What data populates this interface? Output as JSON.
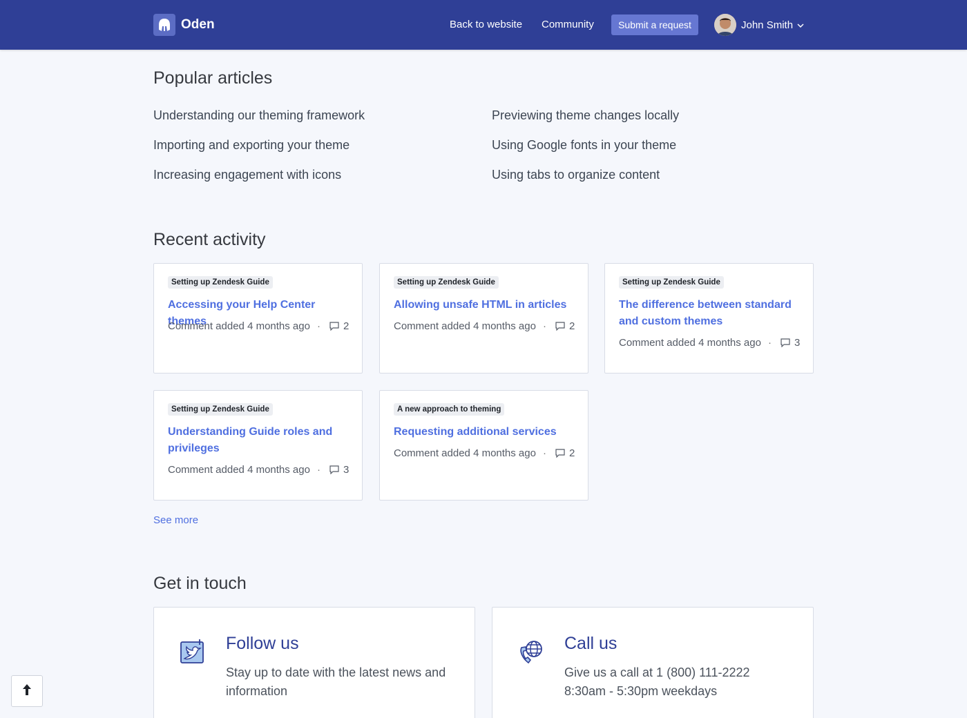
{
  "header": {
    "brand": "Oden",
    "nav": {
      "back_to_website": "Back to website",
      "community": "Community",
      "submit_request": "Submit a request"
    },
    "user_name": "John Smith"
  },
  "popular": {
    "heading": "Popular articles",
    "articles": [
      "Understanding our theming framework",
      "Importing and exporting your theme",
      "Increasing engagement with icons",
      "Previewing theme changes locally",
      "Using Google fonts in your theme",
      "Using tabs to organize content"
    ]
  },
  "recent": {
    "heading": "Recent activity",
    "items": [
      {
        "badge": "Setting up Zendesk Guide",
        "title": "Accessing your Help Center themes",
        "meta": "Comment added 4 months ago",
        "comments": "2"
      },
      {
        "badge": "Setting up Zendesk Guide",
        "title": "Allowing unsafe HTML in articles",
        "meta": "Comment added 4 months ago",
        "comments": "2"
      },
      {
        "badge": "Setting up Zendesk Guide",
        "title": "The difference between standard and custom themes",
        "meta": "Comment added 4 months ago",
        "comments": "3"
      },
      {
        "badge": "Setting up Zendesk Guide",
        "title": "Understanding Guide roles and privileges",
        "meta": "Comment added 4 months ago",
        "comments": "3"
      },
      {
        "badge": "A new approach to theming",
        "title": "Requesting additional services",
        "meta": "Comment added 4 months ago",
        "comments": "2"
      }
    ],
    "see_more": "See more"
  },
  "contact": {
    "heading": "Get in touch",
    "follow": {
      "title": "Follow us",
      "text": "Stay up to date with the latest news and information"
    },
    "call": {
      "title": "Call us",
      "text": "Give us a call at 1 (800) 111-2222 8:30am - 5:30pm weekdays"
    }
  },
  "colors": {
    "header_bg": "#2f3f96",
    "link": "#4f6fe0",
    "button": "#6677d2"
  }
}
